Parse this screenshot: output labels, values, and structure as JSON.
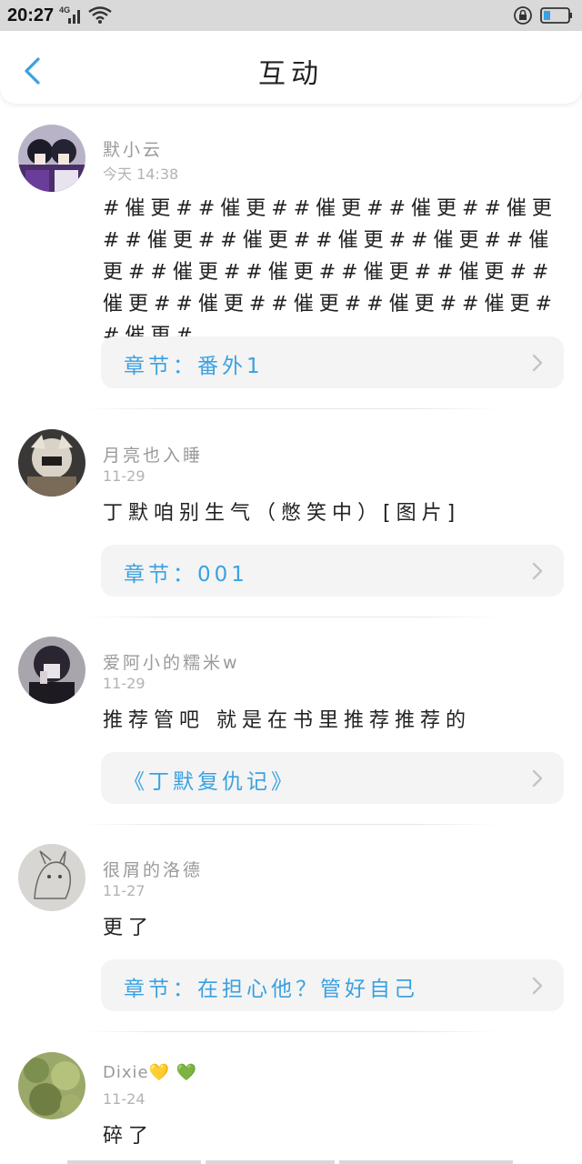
{
  "status_bar": {
    "time": "20:27",
    "network": "4G",
    "icons": [
      "signal-icon",
      "wifi-icon",
      "lock-rotation-icon",
      "battery-icon"
    ]
  },
  "header": {
    "title": "互动",
    "back_icon": "chevron-left-icon"
  },
  "colors": {
    "accent": "#3aa1e0",
    "card_bg": "#f4f4f4",
    "status_bar_bg": "#d9d9d9"
  },
  "feed": [
    {
      "user": "默小云",
      "date": "今天 14:38",
      "content": "#催更##催更##催更##催更##催更##催更##催更##催更##催更##催更##催更##催更##催更##催更##催更##催更##催更##催更##催更##催更#",
      "link": "章节：番外1"
    },
    {
      "user": "月亮也入睡",
      "date": "11-29",
      "content": "丁默咱别生气（憋笑中）[图片]",
      "link": "章节：001"
    },
    {
      "user": "爱阿小的糯米w",
      "date": "11-29",
      "content": "推荐管吧 就是在书里推荐推荐的",
      "link": "《丁默复仇记》"
    },
    {
      "user": "很屑的洛德",
      "date": "11-27",
      "content": "更了",
      "link": "章节：在担心他？管好自己"
    },
    {
      "user": "Dixie💛 💚",
      "date": "11-24",
      "content": "碎了",
      "link": ""
    }
  ]
}
